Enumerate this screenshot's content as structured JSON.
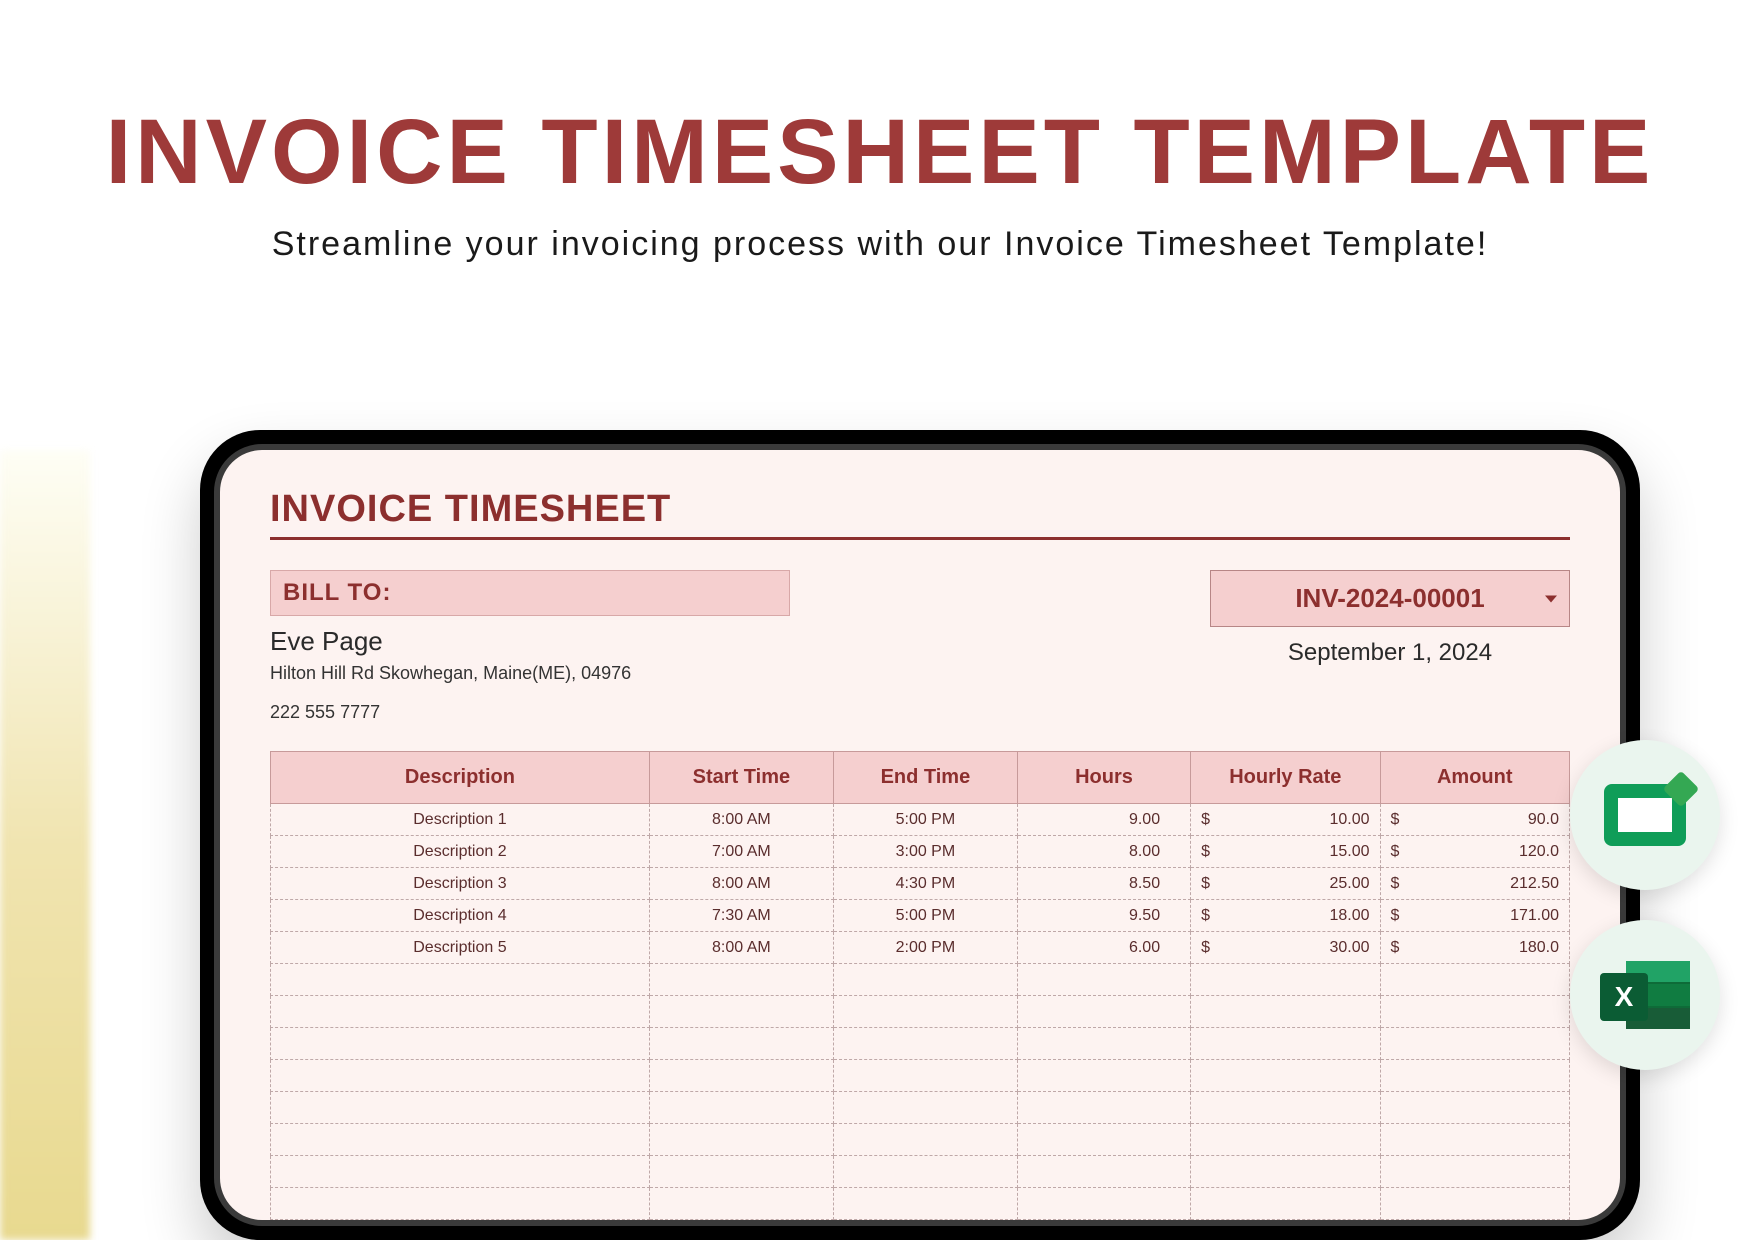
{
  "hero": {
    "title": "INVOICE TIMESHEET TEMPLATE",
    "subtitle": "Streamline your invoicing process with our Invoice Timesheet Template!"
  },
  "sheet": {
    "title": "INVOICE TIMESHEET",
    "bill_to_label": "BILL TO:",
    "bill_to": {
      "name": "Eve Page",
      "address": "Hilton Hill Rd Skowhegan, Maine(ME), 04976",
      "phone": "222 555 7777"
    },
    "invoice_number": "INV-2024-00001",
    "invoice_date": "September 1, 2024",
    "columns": {
      "description": "Description",
      "start_time": "Start Time",
      "end_time": "End Time",
      "hours": "Hours",
      "hourly_rate": "Hourly Rate",
      "amount": "Amount"
    },
    "rows": [
      {
        "description": "Description 1",
        "start": "8:00 AM",
        "end": "5:00 PM",
        "hours": "9.00",
        "rate": "10.00",
        "amount": "90.0"
      },
      {
        "description": "Description 2",
        "start": "7:00 AM",
        "end": "3:00 PM",
        "hours": "8.00",
        "rate": "15.00",
        "amount": "120.0"
      },
      {
        "description": "Description 3",
        "start": "8:00 AM",
        "end": "4:30 PM",
        "hours": "8.50",
        "rate": "25.00",
        "amount": "212.50"
      },
      {
        "description": "Description 4",
        "start": "7:30 AM",
        "end": "5:00 PM",
        "hours": "9.50",
        "rate": "18.00",
        "amount": "171.00"
      },
      {
        "description": "Description 5",
        "start": "8:00 AM",
        "end": "2:00 PM",
        "hours": "6.00",
        "rate": "30.00",
        "amount": "180.0"
      }
    ],
    "empty_rows": 8
  },
  "badges": {
    "google_sheets": "Google Sheets",
    "excel": "Microsoft Excel",
    "excel_letter": "X"
  }
}
